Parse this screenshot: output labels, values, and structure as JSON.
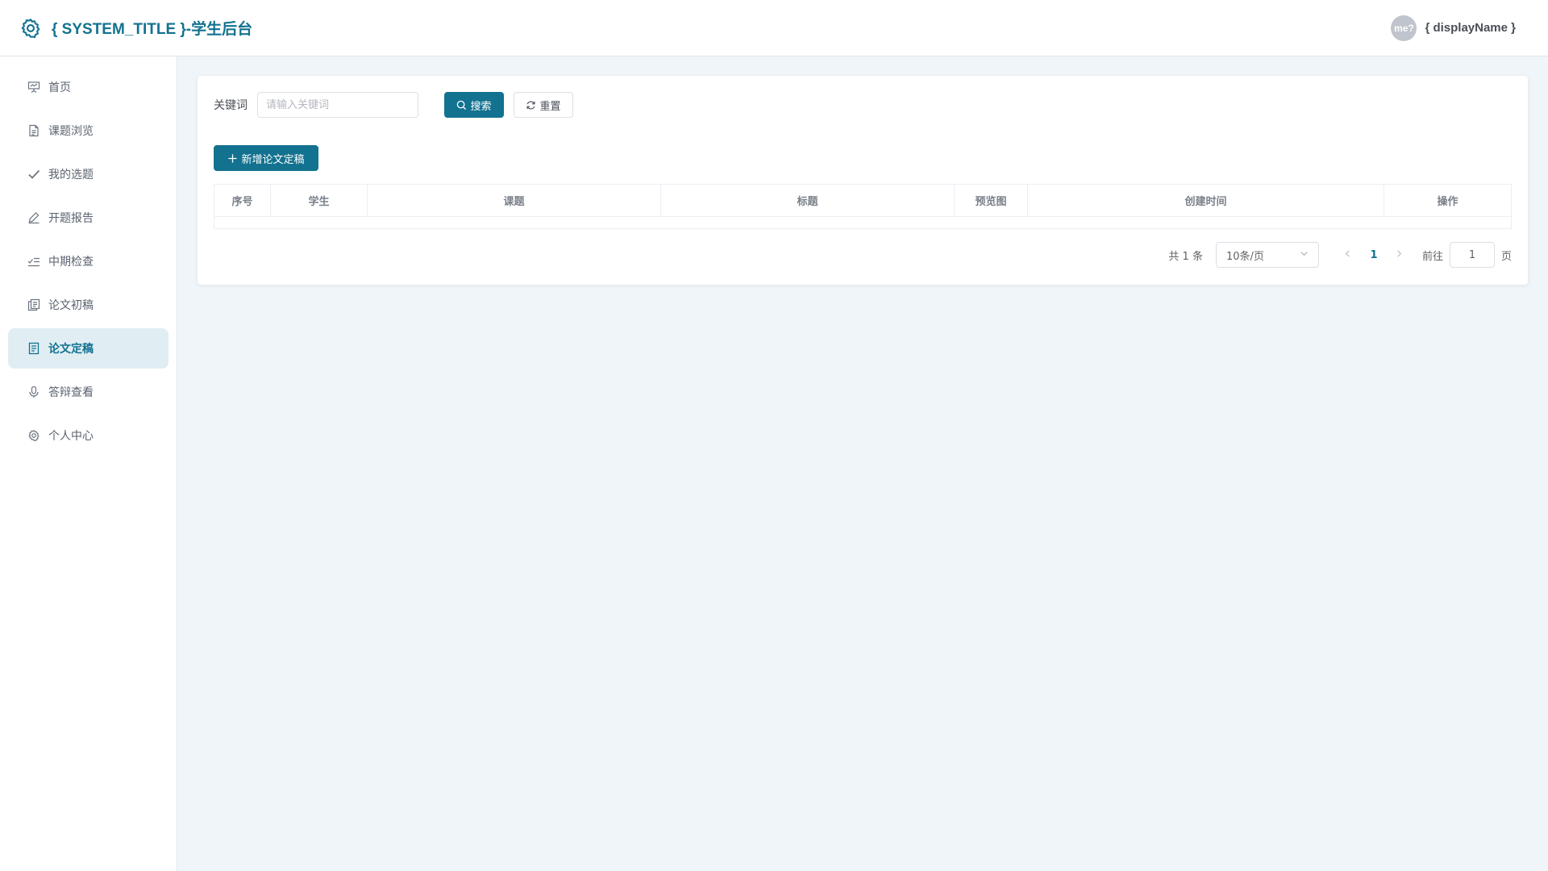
{
  "header": {
    "title": "{ SYSTEM_TITLE }-学生后台",
    "avatar_text": "me?",
    "display_name": "{ displayName }",
    "brand_icon": "gear-icon",
    "accent_color": "#12728f"
  },
  "sidebar": {
    "items": [
      {
        "label": "首页",
        "icon": "presentation-icon"
      },
      {
        "label": "课题浏览",
        "icon": "document-icon"
      },
      {
        "label": "我的选题",
        "icon": "check-icon"
      },
      {
        "label": "开题报告",
        "icon": "edit-pen-icon"
      },
      {
        "label": "中期检查",
        "icon": "checklist-icon"
      },
      {
        "label": "论文初稿",
        "icon": "copy-document-icon"
      },
      {
        "label": "论文定稿",
        "icon": "document-text-icon",
        "active": true
      },
      {
        "label": "答辩查看",
        "icon": "microphone-icon"
      },
      {
        "label": "个人中心",
        "icon": "settings-icon"
      }
    ]
  },
  "search": {
    "label": "关键词",
    "placeholder": "请输入关键词",
    "value": "",
    "search_button": "搜索",
    "reset_button": "重置"
  },
  "toolbar": {
    "add_button": "新增论文定稿"
  },
  "table": {
    "columns": [
      "序号",
      "学生",
      "课题",
      "标题",
      "预览图",
      "创建时间",
      "操作"
    ],
    "rows": []
  },
  "pagination": {
    "total_text": "共 1 条",
    "page_size": "10条/页",
    "current_page": "1",
    "goto_label": "前往",
    "goto_value": "1",
    "page_suffix": "页"
  }
}
